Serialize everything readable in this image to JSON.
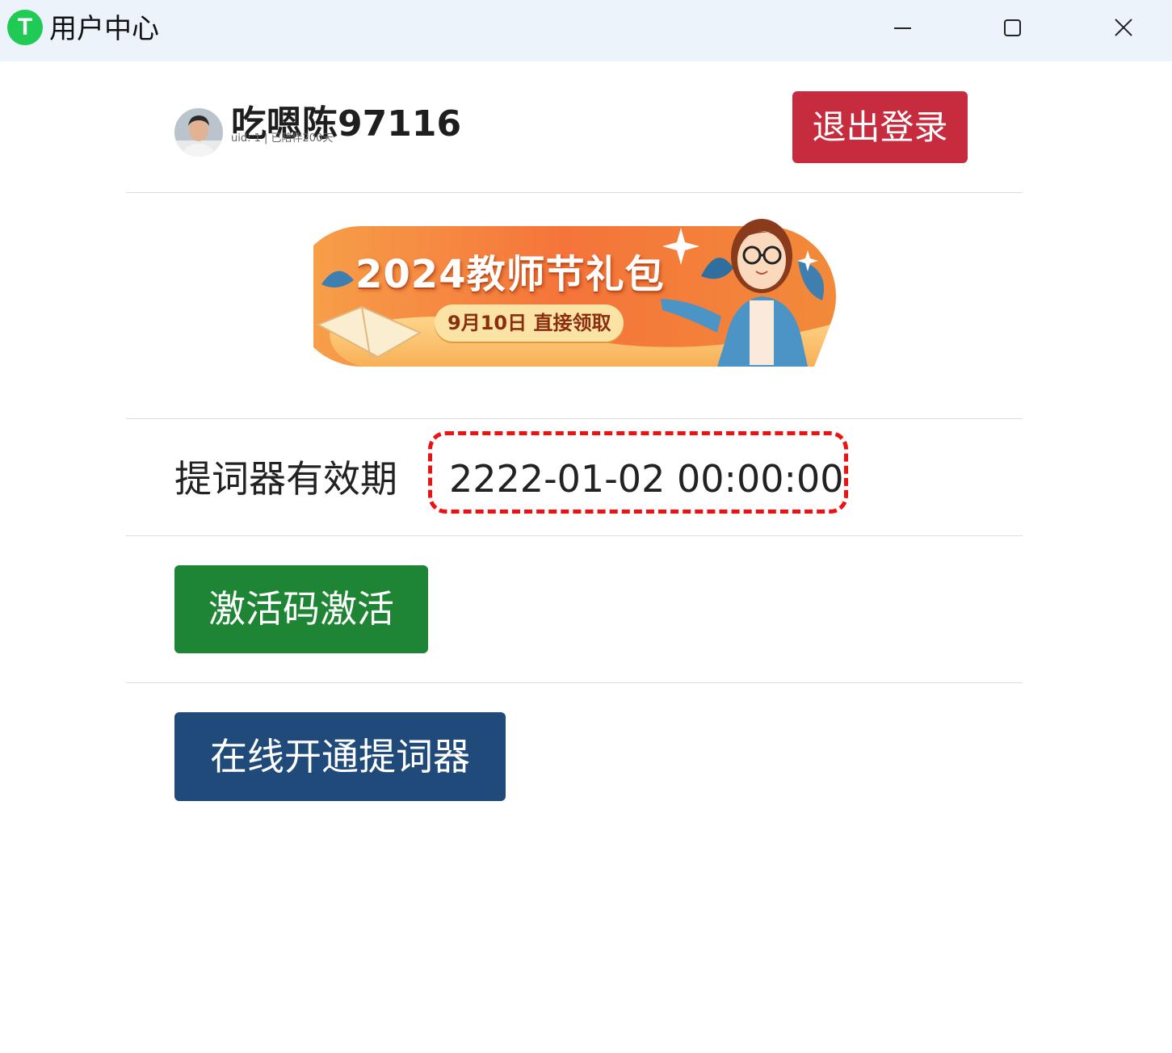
{
  "window": {
    "logo_letter": "T",
    "title": "用户中心",
    "minimize_icon": "minimize-icon",
    "maximize_icon": "maximize-icon",
    "close_icon": "close-icon"
  },
  "user": {
    "name": "吃嗯陈97116",
    "uid_line": "uid: 1 | 已陪伴200天",
    "logout_label": "退出登录",
    "avatar_icon": "user-avatar"
  },
  "banner": {
    "title": "2024教师节礼包",
    "subtitle": "9月10日 直接领取"
  },
  "prompter": {
    "expiry_label": "提词器有效期",
    "expiry_value": "2222-01-02 00:00:00",
    "highlight_color": "#ee1111"
  },
  "actions": {
    "activate_label": "激活码激活",
    "online_label": "在线开通提词器"
  },
  "colors": {
    "titlebar": "#edf3fa",
    "logo": "#1fca55",
    "logout": "#c72c3e",
    "activate": "#1d8533",
    "online": "#1f4a7a"
  }
}
